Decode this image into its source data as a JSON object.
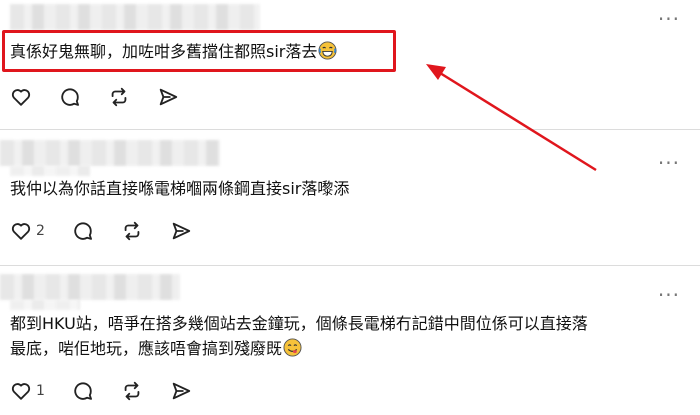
{
  "comments": [
    {
      "text": "真係好鬼無聊，加咗咁多舊擋住都照sir落去",
      "emoji": "laughing-tears-emoji",
      "likes": ""
    },
    {
      "text": "我仲以為你話直接喺電梯嗰兩條鋼直接sir落嚟添",
      "emoji": "",
      "likes": "2"
    },
    {
      "text_line1": "都到HKU站，唔爭在搭多幾個站去金鐘玩，個條長電梯冇記錯中間位係可以直接落",
      "text_line2": "最底，啱佢地玩，應該唔會搞到殘廢既",
      "emoji": "yum-face-emoji",
      "likes": "1"
    }
  ],
  "annotation": {
    "highlight_color": "#e0161d",
    "target": "comment-1"
  },
  "icons": [
    "heart-icon",
    "comment-icon",
    "repost-icon",
    "share-icon",
    "more-options-icon"
  ]
}
